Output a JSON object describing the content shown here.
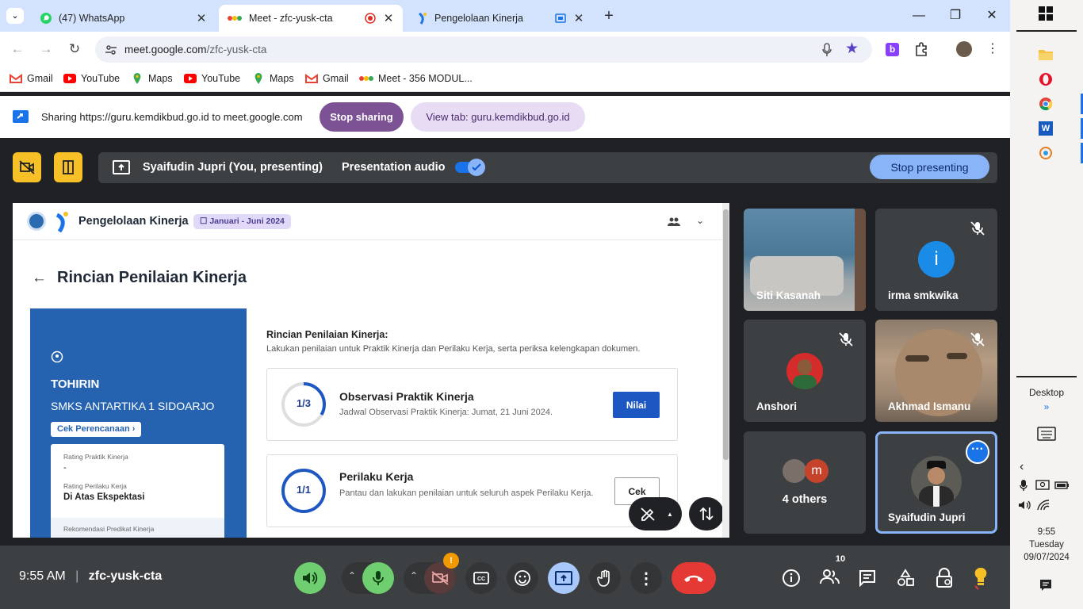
{
  "browser": {
    "tabs": [
      {
        "title": "(47) WhatsApp",
        "icon": "whatsapp-icon",
        "active": false
      },
      {
        "title": "Meet - zfc-yusk-cta",
        "icon": "google-meet-icon",
        "active": true
      },
      {
        "title": "Pengelolaan Kinerja",
        "icon": "kemdikbud-icon",
        "active": false
      }
    ],
    "url_host": "meet.google.com",
    "url_path": "/zfc-yusk-cta",
    "bookmarks": [
      {
        "label": "Gmail",
        "icon": "gmail-icon"
      },
      {
        "label": "YouTube",
        "icon": "youtube-icon"
      },
      {
        "label": "Maps",
        "icon": "maps-icon"
      },
      {
        "label": "YouTube",
        "icon": "youtube-icon"
      },
      {
        "label": "Maps",
        "icon": "maps-icon"
      },
      {
        "label": "Gmail",
        "icon": "gmail-icon"
      },
      {
        "label": "Meet - 356 MODUL...",
        "icon": "google-meet-icon"
      }
    ]
  },
  "sharebar": {
    "text": "Sharing https://guru.kemdikbud.go.id to meet.google.com",
    "stop_label": "Stop sharing",
    "view_label": "View tab: guru.kemdikbud.go.id"
  },
  "presenting": {
    "label": "Syaifudin Jupri (You, presenting)",
    "audio_label": "Presentation audio",
    "audio_on": true,
    "stop_label": "Stop presenting"
  },
  "shared": {
    "app_title": "Pengelolaan Kinerja",
    "period": "Januari - Juni 2024",
    "page_title": "Rincian Penilaian Kinerja",
    "teacher_name": "TOHIRIN",
    "school": "SMKS ANTARTIKA 1 SIDOARJO",
    "plan_button": "Cek Perencanaan",
    "rating_practice_label": "Rating Praktik Kinerja",
    "rating_practice_value": "-",
    "rating_behavior_label": "Rating Perilaku Kerja",
    "rating_behavior_value": "Di Atas Ekspektasi",
    "recommendation_label": "Rekomendasi Predikat Kinerja",
    "section_title": "Rincian Penilaian Kinerja:",
    "section_desc": "Lakukan penilaian untuk Praktik Kinerja dan Perilaku Kerja, serta periksa kelengkapan dokumen.",
    "cards": [
      {
        "progress": "1/3",
        "progress_value": 0.333,
        "title": "Observasi Praktik Kinerja",
        "desc": "Jadwal Observasi Praktik Kinerja: Jumat, 21 Juni 2024.",
        "action": "Nilai"
      },
      {
        "progress": "1/1",
        "progress_value": 1.0,
        "title": "Perilaku Kerja",
        "desc": "Pantau dan lakukan penilaian untuk seluruh aspek Perilaku Kerja.",
        "action": "Cek"
      }
    ]
  },
  "participants": [
    {
      "name": "Siti Kasanah",
      "muted": false,
      "type": "video"
    },
    {
      "name": "irma smkwika",
      "muted": true,
      "type": "avatar",
      "initial": "i",
      "color": "#1a8ce8"
    },
    {
      "name": "Anshori",
      "muted": true,
      "type": "photo"
    },
    {
      "name": "Akhmad Ismanu",
      "muted": true,
      "type": "video"
    },
    {
      "name": "4 others",
      "type": "others",
      "initial": "m"
    },
    {
      "name": "Syaifudin Jupri",
      "type": "self"
    }
  ],
  "bottom": {
    "time": "9:55 AM",
    "meeting_code": "zfc-yusk-cta",
    "participant_count": "10",
    "camera_alert": "!"
  },
  "taskbar": {
    "desktop_label": "Desktop",
    "chevron": "»",
    "clock_time": "9:55",
    "clock_day": "Tuesday",
    "clock_date": "09/07/2024"
  },
  "colors": {
    "tab_bar": "#d3e3fd",
    "stop_sharing_bg": "#7c5295",
    "meet_dark": "#202124",
    "accent_blue": "#1a73e8",
    "end_call_red": "#e53935",
    "highlight_tile": "#8ab4f8",
    "warn_yellow": "#f6c026"
  }
}
